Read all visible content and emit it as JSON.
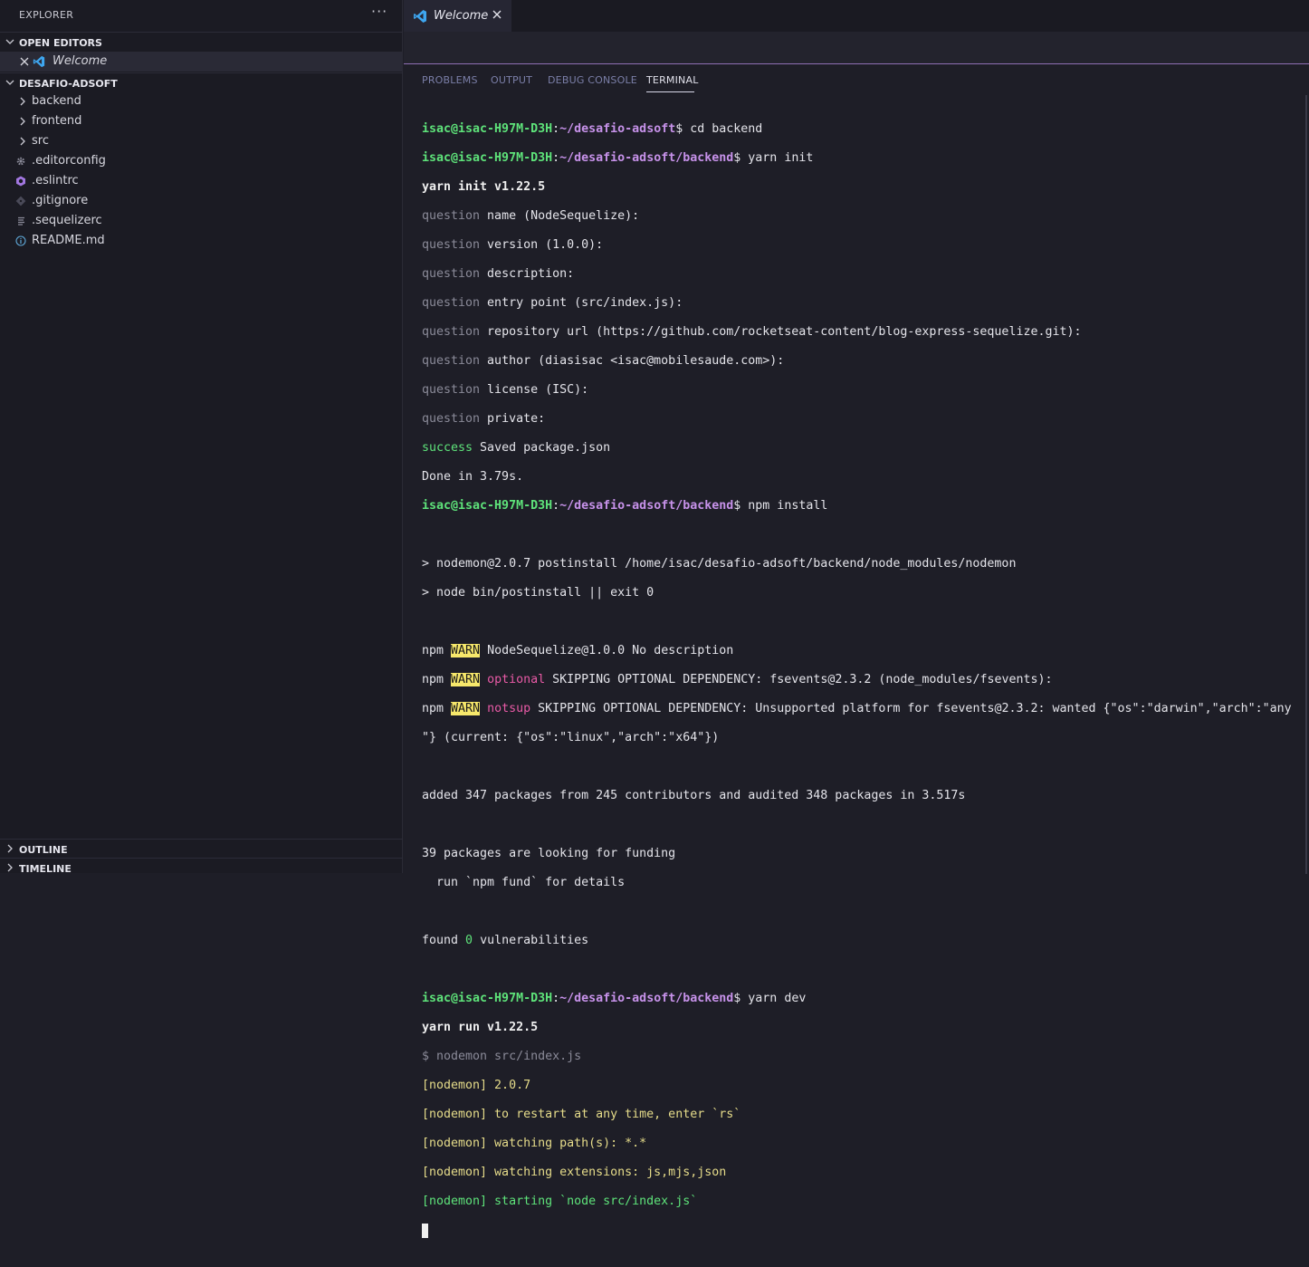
{
  "sidebar": {
    "title": "EXPLORER",
    "more_label": "···",
    "open_editors": {
      "header": "OPEN EDITORS",
      "items": [
        {
          "label": "Welcome"
        }
      ]
    },
    "project": {
      "header": "DESAFIO-ADSOFT",
      "items": [
        {
          "label": "backend",
          "icon": "chevron-right-icon"
        },
        {
          "label": "frontend",
          "icon": "chevron-right-icon"
        },
        {
          "label": "src",
          "icon": "chevron-right-icon"
        },
        {
          "label": ".editorconfig",
          "icon": "gear-icon"
        },
        {
          "label": ".eslintrc",
          "icon": "eslint-icon"
        },
        {
          "label": ".gitignore",
          "icon": "git-icon"
        },
        {
          "label": ".sequelizerc",
          "icon": "list-icon"
        },
        {
          "label": "README.md",
          "icon": "info-icon"
        }
      ]
    },
    "outline_header": "OUTLINE",
    "timeline_header": "TIMELINE"
  },
  "editor": {
    "tabs": [
      {
        "label": "Welcome",
        "active": true
      }
    ]
  },
  "panel": {
    "tabs": [
      {
        "label": "PROBLEMS"
      },
      {
        "label": "OUTPUT"
      },
      {
        "label": "DEBUG CONSOLE"
      },
      {
        "label": "TERMINAL",
        "active": true
      }
    ]
  },
  "terminal": {
    "user": "isac@isac-H97M-D3H",
    "path_root": "~/desafio-adsoft",
    "path_backend": "~/desafio-adsoft/backend",
    "cmd_cd": " cd backend",
    "cmd_yarn_init": " yarn init",
    "yarn_init_version": "yarn init v1.22.5",
    "q_word": "question",
    "questions": [
      " name (NodeSequelize):",
      " version (1.0.0):",
      " description:",
      " entry point (src/index.js):",
      " repository url (https://github.com/rocketseat-content/blog-express-sequelize.git):",
      " author (diasisac <isac@mobilesaude.com>):",
      " license (ISC):",
      " private:"
    ],
    "success_word": "success",
    "success_text": " Saved package.json",
    "done_text": "Done in 3.79s.",
    "cmd_npm_install": " npm install",
    "nodemon_postinstall_1": "> nodemon@2.0.7 postinstall /home/isac/desafio-adsoft/backend/node_modules/nodemon",
    "nodemon_postinstall_2": "> node bin/postinstall || exit 0",
    "npm_word": "npm ",
    "warn_word": "WARN",
    "warn1_text": " NodeSequelize@1.0.0 No description",
    "warn2_tag": " optional",
    "warn2_text": " SKIPPING OPTIONAL DEPENDENCY: fsevents@2.3.2 (node_modules/fsevents):",
    "warn3_tag": " notsup",
    "warn3_text": " SKIPPING OPTIONAL DEPENDENCY: Unsupported platform for fsevents@2.3.2: wanted {\"os\":\"darwin\",\"arch\":\"any",
    "warn3_cont": "\"} (current: {\"os\":\"linux\",\"arch\":\"x64\"})",
    "added_text": "added 347 packages from 245 contributors and audited 348 packages in 3.517s",
    "funding_1": "39 packages are looking for funding",
    "funding_2": "  run `npm fund` for details",
    "found_prefix": "found ",
    "found_count": "0",
    "found_suffix": " vulnerabilities",
    "cmd_yarn_dev": " yarn dev",
    "yarn_run_version": "yarn run v1.22.5",
    "nodemon_cmd": "$ nodemon src/index.js",
    "nodemon_lines": [
      "[nodemon] 2.0.7",
      "[nodemon] to restart at any time, enter `rs`",
      "[nodemon] watching path(s): *.*",
      "[nodemon] watching extensions: js,mjs,json"
    ],
    "nodemon_starting": "[nodemon] starting `node src/index.js`"
  },
  "colors": {
    "accent_purple": "#8f6fb3",
    "prompt_user": "#5ee37a",
    "prompt_path": "#c792ea",
    "warn_bg": "#f7e86b",
    "nodemon_yellow": "#e6dc8a",
    "vscode_blue": "#3ea6f0"
  }
}
